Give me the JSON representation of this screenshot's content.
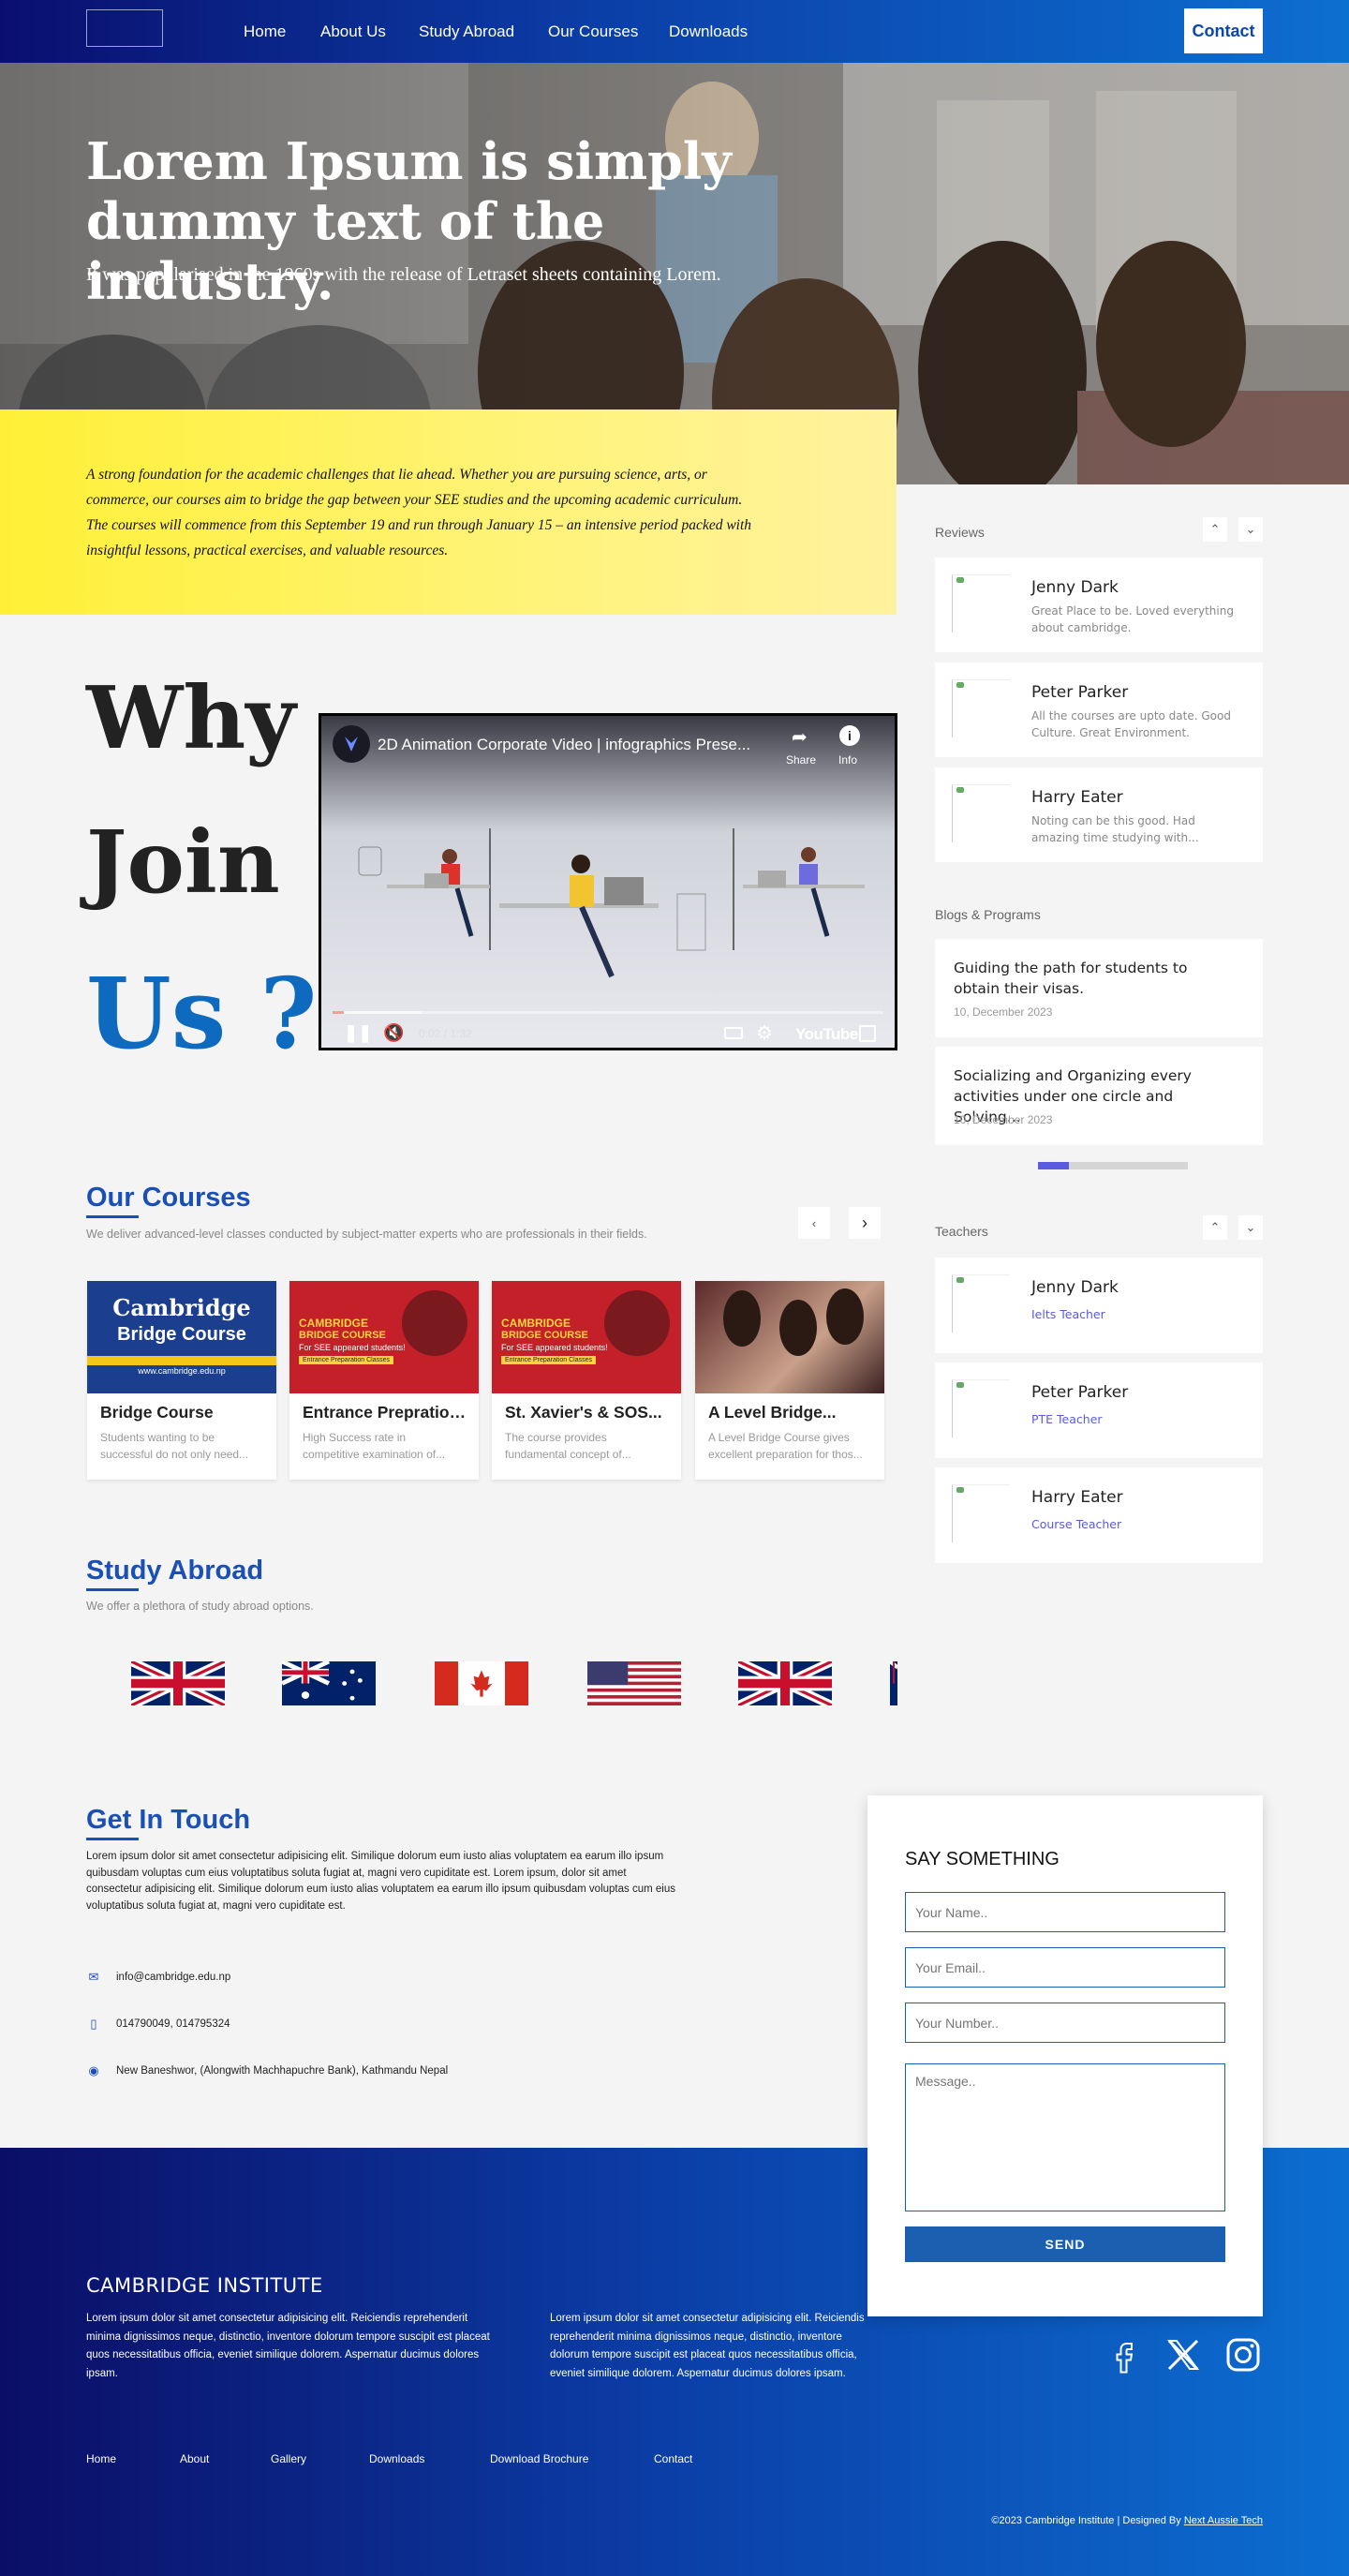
{
  "nav": {
    "links": [
      "Home",
      "About Us",
      "Study Abroad",
      "Our Courses",
      "Downloads"
    ],
    "contact": "Contact"
  },
  "hero": {
    "title": "Lorem Ipsum is simply dummy text of the industry.",
    "subtitle": "It was popularised in the 1960s with the release of Letraset sheets containing Lorem."
  },
  "intro": {
    "text": "A strong foundation for the academic challenges that lie ahead. Whether you are pursuing science, arts, or commerce, our courses aim to bridge the gap between your SEE studies and the upcoming academic curriculum. The courses will commence from this September 19 and run through January 15 – an intensive period packed with insightful lessons, practical exercises, and valuable resources."
  },
  "why": {
    "line1": "Why",
    "line2": "Join",
    "line3": "Us ?"
  },
  "video": {
    "title": "2D Animation Corporate Video | infographics Prese...",
    "share": "Share",
    "info": "Info",
    "time": "0:02 / 1:32",
    "brand": "YouTube",
    "progress": 0.02
  },
  "reviews": {
    "title": "Reviews",
    "items": [
      {
        "name": "Jenny Dark",
        "text": "Great Place to be. Loved everything about cambridge."
      },
      {
        "name": "Peter Parker",
        "text": "All the courses are upto date. Good Culture. Great Environment."
      },
      {
        "name": "Harry Eater",
        "text": "Noting can be this good. Had amazing time studying with..."
      }
    ]
  },
  "blogs": {
    "title": "Blogs & Programs",
    "items": [
      {
        "title": "Guiding the path for students to obtain their visas.",
        "date": "10, December 2023"
      },
      {
        "title": "Socializing and Organizing every activities under one circle and Solving...",
        "date": "10, December 2023"
      }
    ]
  },
  "teachers": {
    "title": "Teachers",
    "items": [
      {
        "name": "Jenny Dark",
        "role": "Ielts Teacher"
      },
      {
        "name": "Peter Parker",
        "role": "PTE Teacher"
      },
      {
        "name": "Harry Eater",
        "role": "Course Teacher"
      }
    ]
  },
  "courses": {
    "title": "Our Courses",
    "subtitle": "We deliver advanced-level classes conducted by subject-matter experts who are professionals in their fields.",
    "items": [
      {
        "title": "Bridge Course",
        "text": "Students wanting to be successful do not only need..."
      },
      {
        "title": "Entrance Prepration...",
        "text": "High Success rate in competitive examination of..."
      },
      {
        "title": "St. Xavier's & SOS...",
        "text": "The course provides fundamental concept of..."
      },
      {
        "title": "A Level Bridge...",
        "text": "A Level Bridge Course gives excellent preparation for thos..."
      }
    ],
    "img1": {
      "line1": "Cambridge",
      "line2": "Bridge Course",
      "url": "www.cambridge.edu.np"
    },
    "img2": {
      "line1": "CAMBRIDGE",
      "line2": "BRIDGE COURSE",
      "line3": "For SEE appeared students!",
      "line4": "Entrance Preparation Classes"
    }
  },
  "abroad": {
    "title": "Study Abroad",
    "subtitle": "We offer a plethora of study abroad options.",
    "flags": [
      "uk-flag",
      "australia-flag",
      "canada-flag",
      "usa-flag",
      "uk-flag",
      "australia-flag"
    ]
  },
  "touch": {
    "title": "Get In Touch",
    "text": "Lorem ipsum dolor sit amet consectetur adipisicing elit. Similique dolorum eum iusto alias voluptatem ea earum illo ipsum quibusdam voluptas cum eius voluptatibus soluta fugiat at, magni vero cupiditate est. Lorem ipsum, dolor sit amet consectetur adipisicing elit. Similique dolorum eum iusto alias voluptatem ea earum illo ipsum quibusdam voluptas cum eius voluptatibus soluta fugiat at, magni vero cupiditate est.",
    "email": "info@cambridge.edu.np",
    "phone": "014790049, 014795324",
    "address": "New Baneshwor, (Alongwith Machhapuchre Bank), Kathmandu Nepal"
  },
  "form": {
    "title": "SAY SOMETHING",
    "name_placeholder": "Your Name..",
    "email_placeholder": "Your Email..",
    "number_placeholder": "Your Number..",
    "message_placeholder": "Message..",
    "send": "SEND"
  },
  "footer": {
    "title": "CAMBRIDGE INSTITUTE",
    "text1": "Lorem ipsum dolor sit amet consectetur adipisicing elit. Reiciendis reprehenderit minima dignissimos neque, distinctio, inventore dolorum tempore suscipit est placeat quos necessitatibus officia, eveniet similique dolorem. Aspernatur ducimus dolores ipsam.",
    "text2": "Lorem ipsum dolor sit amet consectetur adipisicing elit. Reiciendis reprehenderit minima dignissimos neque, distinctio, inventore dolorum tempore suscipit est placeat quos necessitatibus officia, eveniet similique dolorem. Aspernatur ducimus dolores ipsam.",
    "links": [
      "Home",
      "About",
      "Gallery",
      "Downloads",
      "Download Brochure",
      "Contact"
    ],
    "copyright": "©2023 Cambridge Institute | Designed By ",
    "designer": "Next Aussie Tech"
  },
  "colors": {
    "brand": "#1a4fb5",
    "nav_start": "#0a0f6e",
    "nav_end": "#0d6fd0",
    "yellow": "#fff036",
    "why_accent": "#0e6abf"
  }
}
